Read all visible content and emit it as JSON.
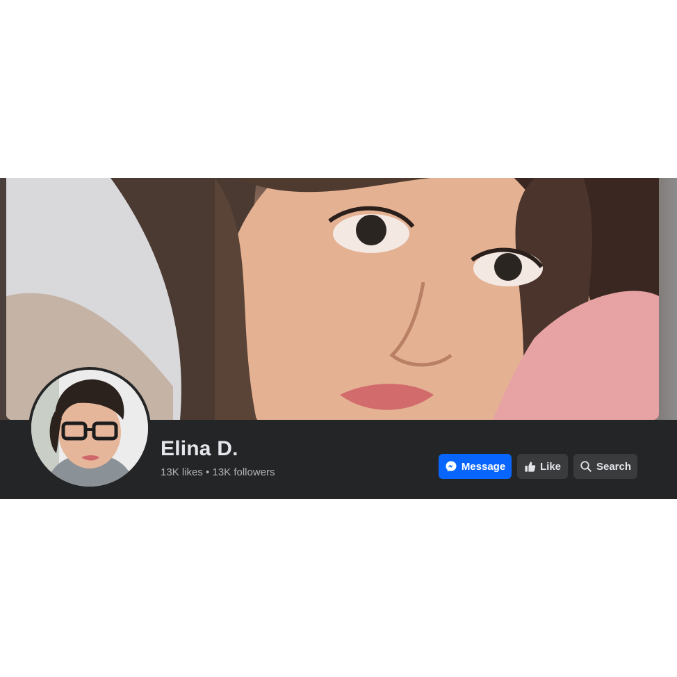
{
  "page": {
    "name": "Elina D.",
    "likes": "13K likes",
    "separator": "•",
    "followers": "13K followers"
  },
  "actions": {
    "message_label": "Message",
    "like_label": "Like",
    "search_label": "Search"
  },
  "icons": {
    "message": "messenger-icon",
    "like": "thumbs-up-icon",
    "search": "magnifier-icon"
  },
  "colors": {
    "header_bg": "#242526",
    "primary_button": "#0866ff",
    "secondary_button": "#3a3b3c",
    "name_text": "#e4e6eb",
    "stats_text": "#b0b3b8"
  }
}
